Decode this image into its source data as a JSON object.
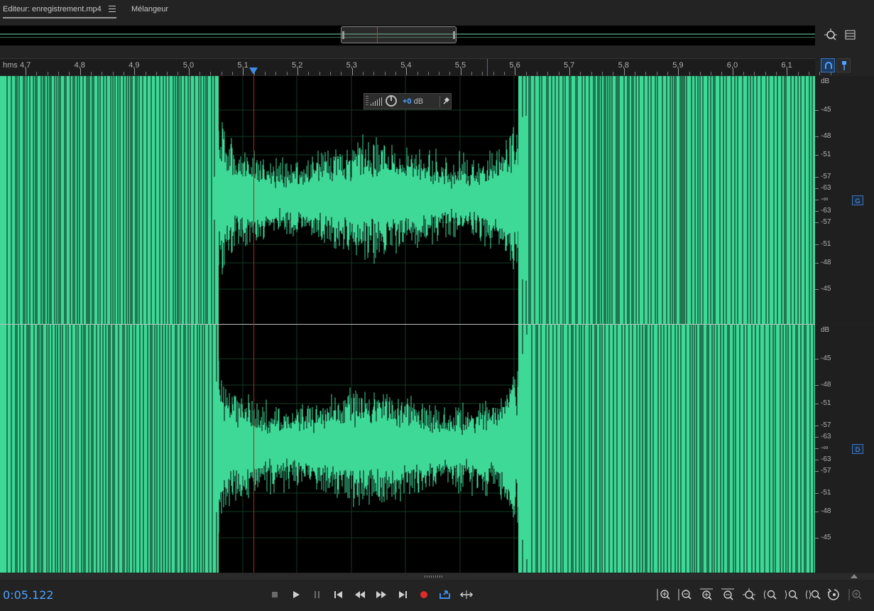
{
  "tabs": {
    "editor_label": "Editeur: enregistrement.mp4",
    "mixer_label": "Mélangeur"
  },
  "ruler": {
    "unit": "hms",
    "ticks": [
      "4,7",
      "4,8",
      "4,9",
      "5,0",
      "5,1",
      "5,2",
      "5,3",
      "5,4",
      "5,5",
      "5,6",
      "5,7",
      "5,8",
      "5,9",
      "6,0",
      "6,1"
    ]
  },
  "hud": {
    "gain_value": "+0",
    "gain_unit": "dB"
  },
  "channels": {
    "left": {
      "badge": "G",
      "scale": [
        "dB",
        "-45",
        "-48",
        "-51",
        "-57",
        "-63",
        "-∞",
        "-63",
        "-57",
        "-51",
        "-48",
        "-45"
      ]
    },
    "right": {
      "badge": "D",
      "scale": [
        "dB",
        "-45",
        "-48",
        "-51",
        "-57",
        "-63",
        "-∞",
        "-63",
        "-57",
        "-51",
        "-48",
        "-45"
      ]
    }
  },
  "transport": {
    "time": "0:05.122"
  },
  "colors": {
    "waveform": "#3ed897",
    "playhead": "#b3261e",
    "accent": "#4da3ff",
    "background": "#000000"
  },
  "icons": {
    "transport": [
      "stop-icon",
      "play-icon",
      "pause-icon",
      "go-to-start-icon",
      "rewind-icon",
      "fast-forward-icon",
      "go-to-end-icon",
      "record-icon",
      "loop-icon",
      "skip-icon"
    ],
    "zoom": [
      "zoom-in-amplitude-icon",
      "zoom-out-amplitude-icon",
      "zoom-in-time-icon",
      "zoom-out-time-icon",
      "zoom-out-full-icon",
      "zoom-in-start-icon",
      "zoom-in-end-icon",
      "zoom-selection-icon",
      "zoom-reset-icon",
      "zoom-toggle-icon"
    ]
  }
}
